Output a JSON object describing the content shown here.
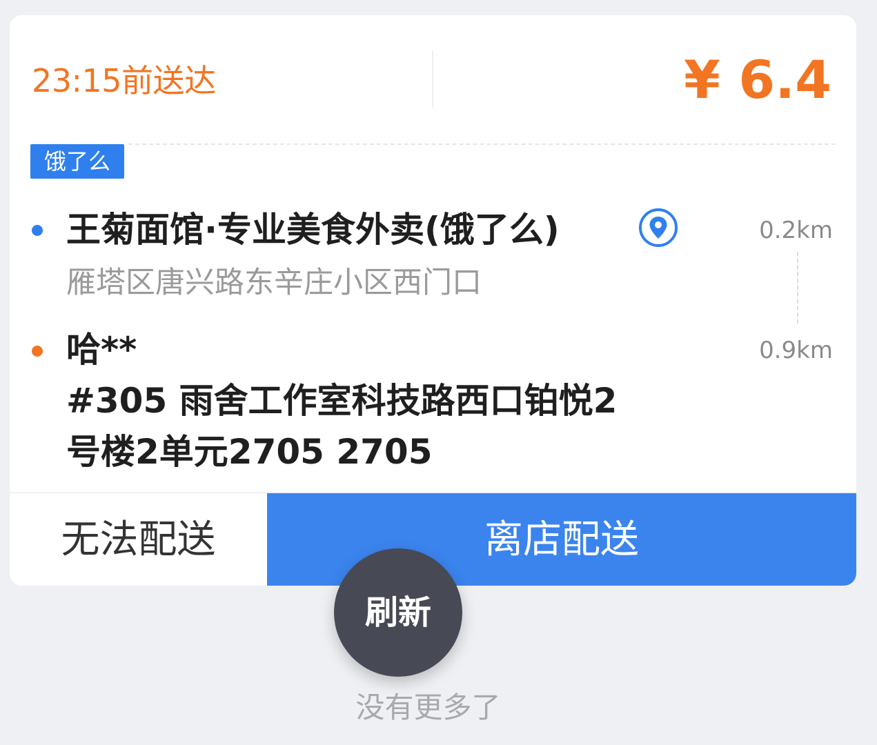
{
  "order": {
    "deadline_text": "23:15前送达",
    "price_text": "¥ 6.4",
    "platform_tag": "饿了么",
    "pickup": {
      "store_name": "王菊面馆·专业美食外卖(饿了么)",
      "address": "雁塔区唐兴路东辛庄小区西门口",
      "distance": "0.2km",
      "pin_icon": "location-pin-icon"
    },
    "dropoff": {
      "customer_name": "哈**",
      "address_line1": "#305 雨舍工作室科技路西口铂悦2",
      "address_line2": "号楼2单元2705 2705",
      "distance": "0.9km"
    }
  },
  "actions": {
    "cannot_deliver_label": "无法配送",
    "depart_label": "离店配送"
  },
  "refresh_label": "刷新",
  "footer_text": "没有更多了",
  "colors": {
    "accent_orange": "#f27523",
    "accent_blue": "#3b84ee",
    "refresh_bg": "#474a54",
    "page_bg": "#eef0f3"
  }
}
